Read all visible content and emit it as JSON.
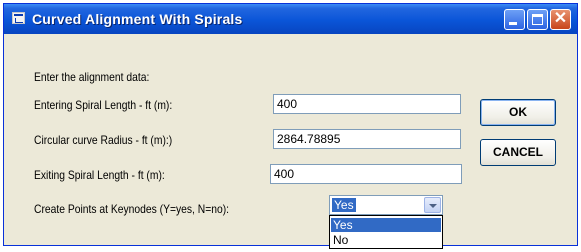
{
  "window": {
    "title": "Curved Alignment With Spirals"
  },
  "form": {
    "intro": "Enter the alignment data:",
    "fields": [
      {
        "label": "Entering Spiral Length - ft (m):",
        "value": "400"
      },
      {
        "label": "Circular curve Radius - ft (m):)",
        "value": "2864.78895"
      },
      {
        "label": "Exiting Spiral Length - ft (m):",
        "value": "400"
      }
    ],
    "keynodes": {
      "label": "Create Points at Keynodes (Y=yes, N=no):",
      "selected": "Yes",
      "options": [
        "Yes",
        "No"
      ]
    }
  },
  "buttons": {
    "ok": "OK",
    "cancel": "CANCEL"
  }
}
